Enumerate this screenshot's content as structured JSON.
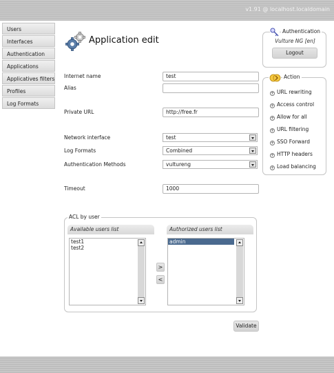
{
  "header": {
    "host": "v1.91 @ localhost.localdomain"
  },
  "nav": {
    "items": [
      {
        "label": "Users"
      },
      {
        "label": "Interfaces"
      },
      {
        "label": "Authentication"
      },
      {
        "label": "Applications"
      },
      {
        "label": "Applicatives filters"
      },
      {
        "label": "Profiles"
      },
      {
        "label": "Log Formats"
      }
    ]
  },
  "page": {
    "title": "Application edit",
    "icon": "gears-icon"
  },
  "form": {
    "internet_name": {
      "label": "Internet name",
      "value": "test"
    },
    "alias": {
      "label": "Alias",
      "value": ""
    },
    "private_url": {
      "label": "Private URL",
      "value": "http://free.fr"
    },
    "network_interface": {
      "label": "Network interface",
      "value": "test"
    },
    "log_formats": {
      "label": "Log Formats",
      "value": "Combined"
    },
    "auth_methods": {
      "label": "Authentication Methods",
      "value": "vultureng"
    },
    "timeout": {
      "label": "Timeout",
      "value": "1000"
    }
  },
  "acl": {
    "legend": "ACL by user",
    "available_title": "Available users list",
    "authorized_title": "Authorized users list",
    "available": [
      "test1",
      "test2"
    ],
    "authorized": [
      "admin"
    ],
    "add_label": ">",
    "remove_label": "<"
  },
  "validate_label": "Validate",
  "auth_panel": {
    "legend": "Authentication",
    "user_line": "Vulture NG [en]",
    "logout_label": "Logout"
  },
  "action_panel": {
    "legend": "Action",
    "items": [
      {
        "label": "URL rewriting"
      },
      {
        "label": "Access control"
      },
      {
        "label": "Allow for all"
      },
      {
        "label": "URL filtering"
      },
      {
        "label": "SSO Forward"
      },
      {
        "label": "HTTP headers"
      },
      {
        "label": "Load balancing"
      }
    ]
  },
  "colors": {
    "selection": "#4a6a8f",
    "bar": "#bfbfbf"
  }
}
